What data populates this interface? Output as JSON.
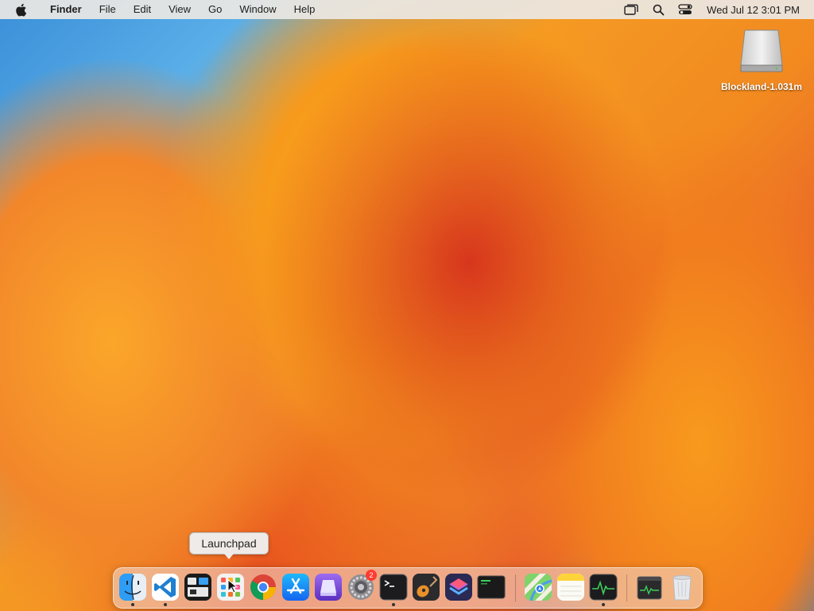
{
  "menubar": {
    "app_name": "Finder",
    "items": [
      "File",
      "Edit",
      "View",
      "Go",
      "Window",
      "Help"
    ],
    "clock": "Wed Jul 12  3:01 PM",
    "icons": [
      "apple-icon",
      "screen-mirror-icon",
      "search-icon",
      "control-center-icon"
    ]
  },
  "desktop": {
    "disk_label": "Blockland-1.031m"
  },
  "tooltip": {
    "text": "Launchpad"
  },
  "dock": {
    "apps": [
      "finder",
      "vscode",
      "mission-control",
      "launchpad",
      "chrome",
      "app-store",
      "storage-app",
      "system-settings",
      "terminal",
      "instruments",
      "shortcuts",
      "console",
      "maps",
      "notes",
      "activity-monitor",
      "activity-monitor-window",
      "trash"
    ],
    "system_settings_badge": "2"
  },
  "colors": {
    "menubar_bg": "#ece8e4",
    "badge": "#ff3b30",
    "wallpaper_orange": "#f49a24",
    "wallpaper_blue": "#3a8fd8"
  }
}
